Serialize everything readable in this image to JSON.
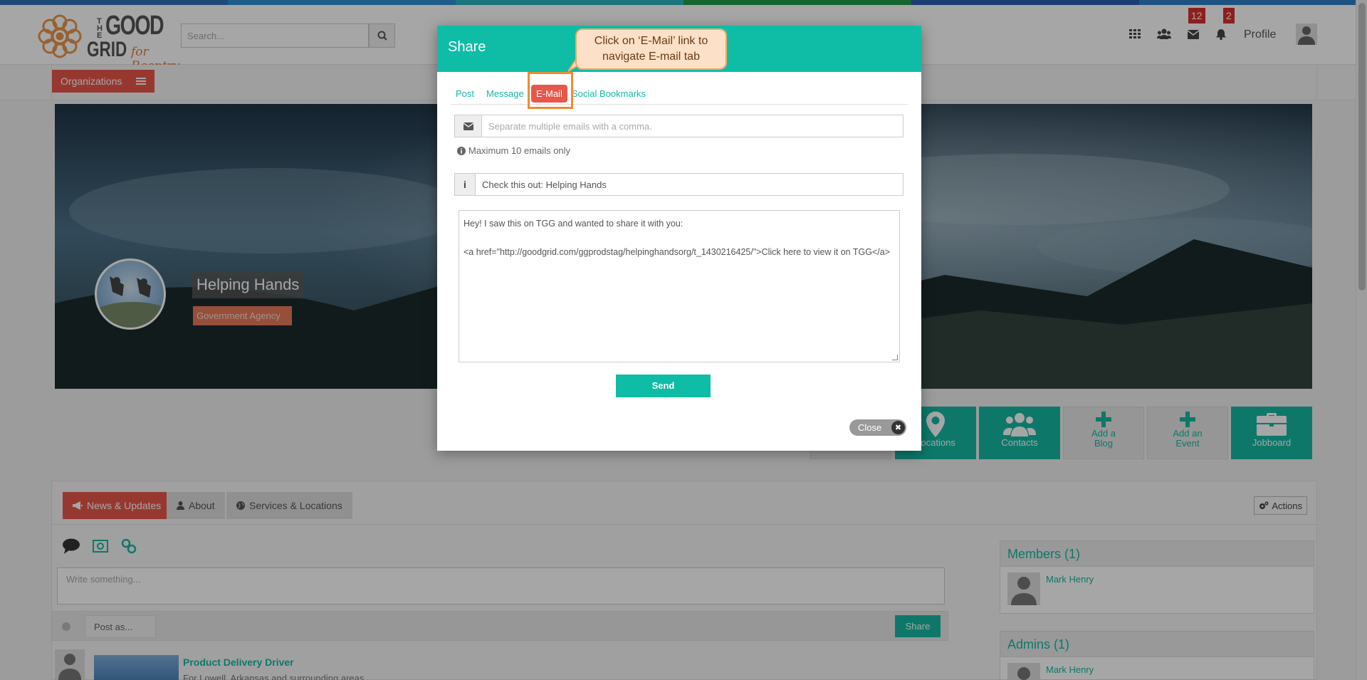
{
  "colors": {
    "accent": "#0fbca6",
    "brand_red": "#e8574a",
    "callout_bg": "#fde0c8",
    "highlight": "#f08a32",
    "badge": "#d9302c"
  },
  "header": {
    "logo": {
      "the": "THE",
      "good": "GOOD",
      "grid": "GRID",
      "tagline": "for Reentry"
    },
    "search_placeholder": "Search...",
    "icons": [
      "grid-icon",
      "users-icon",
      "envelope-icon",
      "bell-icon"
    ],
    "messages_count": "12",
    "notifications_count": "2",
    "profile_label": "Profile"
  },
  "subnav": {
    "organizations_label": "Organizations"
  },
  "organization": {
    "name": "Helping Hands",
    "type": "Government Agency"
  },
  "tiles": {
    "locations": "Locations",
    "contacts": "Contacts",
    "add_blog": "Add a Blog",
    "add_event": "Add an Event",
    "jobboard": "Jobboard"
  },
  "tabs": {
    "news": "News & Updates",
    "about": "About",
    "services": "Services & Locations",
    "actions": "Actions"
  },
  "feed": {
    "write_placeholder": "Write something...",
    "post_as": "Post as...",
    "share_label": "Share",
    "item_title": "Product Delivery Driver",
    "item_subtitle": "For Lowell, Arkansas and surrounding areas"
  },
  "sidebar": {
    "members_title": "Members (1)",
    "members": [
      "Mark Henry"
    ],
    "admins_title": "Admins (1)",
    "admins": [
      "Mark Henry"
    ]
  },
  "modal": {
    "title": "Share",
    "tabs": [
      "Post",
      "Message",
      "E-Mail",
      "Social Bookmarks"
    ],
    "active_tab": "E-Mail",
    "email_placeholder": "Separate multiple emails with a comma.",
    "max_note": "Maximum 10 emails only",
    "subject_value": "Check this out: Helping Hands",
    "message_line1": "Hey! I saw this on TGG and wanted to share it with you:",
    "message_line2": "<a href=\"http://goodgrid.com/ggprodstag/helpinghandsorg/t_1430216425/\">Click here to view it on TGG</a>",
    "send_label": "Send",
    "close_label": "Close"
  },
  "callout": {
    "text": "Click on ‘E-Mail’ link to navigate E-mail tab"
  }
}
